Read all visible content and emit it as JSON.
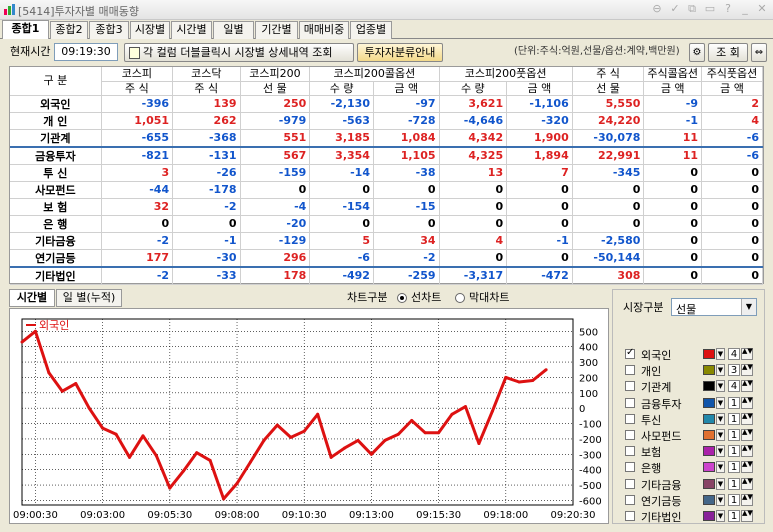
{
  "window": {
    "title": "[5414]투자자별 매매동향"
  },
  "tabs": [
    "종합1",
    "종합2",
    "종합3",
    "시장별",
    "시간별",
    "일별",
    "기간별",
    "매매비중",
    "업종별"
  ],
  "toolbar": {
    "time_label": "현재시간",
    "time_value": "09:19:30",
    "notice_button": "각 컬럼 더블클릭시 시장별 상세내역 조회",
    "classify_button": "투자자분류안내",
    "unit_text": "(단위:주식:억원,선물/옵션:계약,백만원)",
    "query_button": "조 회"
  },
  "table": {
    "header_top": [
      "구 분",
      "코스피",
      "코스닥",
      "코스피200",
      "코스피200콜옵션",
      "코스피200풋옵션",
      "주 식",
      "주식콜옵션",
      "주식풋옵션"
    ],
    "header_bottom": [
      "주 식",
      "주 식",
      "선 물",
      "수 량",
      "금 액",
      "수 량",
      "금 액",
      "선 물",
      "금 액",
      "금 액"
    ],
    "rows": [
      {
        "label": "외국인",
        "values": [
          "-396",
          "139",
          "250",
          "-2,130",
          "-97",
          "3,621",
          "-1,106",
          "5,550",
          "-9",
          "2"
        ]
      },
      {
        "label": "개 인",
        "values": [
          "1,051",
          "262",
          "-979",
          "-563",
          "-728",
          "-4,646",
          "-320",
          "24,220",
          "-1",
          "4"
        ]
      },
      {
        "label": "기관계",
        "values": [
          "-655",
          "-368",
          "551",
          "3,185",
          "1,084",
          "4,342",
          "1,900",
          "-30,078",
          "11",
          "-6"
        ]
      },
      {
        "label": "금융투자",
        "values": [
          "-821",
          "-131",
          "567",
          "3,354",
          "1,105",
          "4,325",
          "1,894",
          "22,991",
          "11",
          "-6"
        ]
      },
      {
        "label": "투 신",
        "values": [
          "3",
          "-26",
          "-159",
          "-14",
          "-38",
          "13",
          "7",
          "-345",
          "0",
          "0"
        ]
      },
      {
        "label": "사모펀드",
        "values": [
          "-44",
          "-178",
          "0",
          "0",
          "0",
          "0",
          "0",
          "0",
          "0",
          "0"
        ]
      },
      {
        "label": "보 험",
        "values": [
          "32",
          "-2",
          "-4",
          "-154",
          "-15",
          "0",
          "0",
          "0",
          "0",
          "0"
        ]
      },
      {
        "label": "은 행",
        "values": [
          "0",
          "0",
          "-20",
          "0",
          "0",
          "0",
          "0",
          "0",
          "0",
          "0"
        ]
      },
      {
        "label": "기타금융",
        "values": [
          "-2",
          "-1",
          "-129",
          "5",
          "34",
          "4",
          "-1",
          "-2,580",
          "0",
          "0"
        ]
      },
      {
        "label": "연기금등",
        "values": [
          "177",
          "-30",
          "296",
          "-6",
          "-2",
          "0",
          "0",
          "-50,144",
          "0",
          "0"
        ]
      },
      {
        "label": "기타법인",
        "values": [
          "-2",
          "-33",
          "178",
          "-492",
          "-259",
          "-3,317",
          "-472",
          "308",
          "0",
          "0"
        ]
      }
    ]
  },
  "lower_tabs": [
    "시간별",
    "일 별(누적)"
  ],
  "chart_controls": {
    "kind_label": "차트구분",
    "option_line": "선차트",
    "option_bar": "막대차트"
  },
  "market": {
    "label": "시장구분",
    "value": "선물"
  },
  "series_list": [
    {
      "name": "외국인",
      "checked": true,
      "color": "#dd1111",
      "width": "4"
    },
    {
      "name": "개인",
      "checked": false,
      "color": "#888800",
      "width": "3"
    },
    {
      "name": "기관계",
      "checked": false,
      "color": "#000000",
      "width": "4"
    },
    {
      "name": "금융투자",
      "checked": false,
      "color": "#1155aa",
      "width": "1"
    },
    {
      "name": "투신",
      "checked": false,
      "color": "#2288aa",
      "width": "1"
    },
    {
      "name": "사모펀드",
      "checked": false,
      "color": "#e07030",
      "width": "1"
    },
    {
      "name": "보험",
      "checked": false,
      "color": "#aa22aa",
      "width": "1"
    },
    {
      "name": "은행",
      "checked": false,
      "color": "#cc44cc",
      "width": "1"
    },
    {
      "name": "기타금융",
      "checked": false,
      "color": "#884466",
      "width": "1"
    },
    {
      "name": "연기금등",
      "checked": false,
      "color": "#446688",
      "width": "1"
    },
    {
      "name": "기타법인",
      "checked": false,
      "color": "#882299",
      "width": "1"
    }
  ],
  "chart_data": {
    "type": "line",
    "legend": "외국인",
    "series": [
      {
        "name": "외국인",
        "color": "#dd1111",
        "x": [
          "09:00:00",
          "09:00:30",
          "09:01:00",
          "09:01:30",
          "09:02:00",
          "09:02:30",
          "09:03:00",
          "09:03:30",
          "09:04:00",
          "09:04:30",
          "09:05:00",
          "09:05:30",
          "09:06:00",
          "09:06:30",
          "09:07:00",
          "09:07:30",
          "09:08:00",
          "09:08:30",
          "09:09:00",
          "09:09:30",
          "09:10:00",
          "09:10:30",
          "09:11:00",
          "09:11:30",
          "09:12:00",
          "09:12:30",
          "09:13:00",
          "09:13:30",
          "09:14:00",
          "09:14:30",
          "09:15:00",
          "09:15:30",
          "09:16:00",
          "09:16:30",
          "09:17:00",
          "09:17:30",
          "09:18:00",
          "09:18:30",
          "09:19:00",
          "09:19:30"
        ],
        "values": [
          430,
          500,
          230,
          110,
          160,
          0,
          -130,
          -170,
          -320,
          -180,
          -310,
          -520,
          -410,
          -290,
          -340,
          -590,
          -490,
          -350,
          -210,
          -110,
          -190,
          -150,
          -40,
          -320,
          -260,
          -210,
          -300,
          -210,
          -170,
          -80,
          -160,
          -160,
          -40,
          10,
          -230,
          -20,
          200,
          170,
          180,
          250
        ]
      }
    ],
    "xticks": [
      "09:00:30",
      "09:03:00",
      "09:05:30",
      "09:08:00",
      "09:10:30",
      "09:13:00",
      "09:15:30",
      "09:18:00",
      "09:20:30"
    ],
    "yticks": [
      500,
      400,
      300,
      200,
      100,
      0,
      -100,
      -200,
      -300,
      -400,
      -500,
      -600
    ],
    "ylim": [
      -630,
      580
    ],
    "grid": true,
    "legend_position": "top-left"
  }
}
